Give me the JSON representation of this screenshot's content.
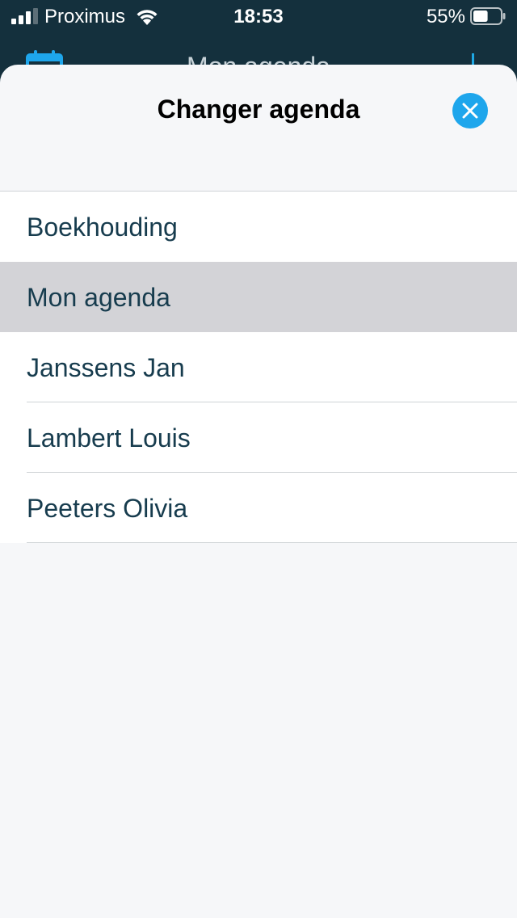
{
  "status_bar": {
    "carrier": "Proximus",
    "time": "18:53",
    "battery": "55%",
    "battery_level": 0.55
  },
  "background_header": {
    "title": "Mon agenda"
  },
  "sheet": {
    "title": "Changer agenda",
    "close_icon": "close-icon"
  },
  "agendas": [
    {
      "label": "Boekhouding",
      "selected": false
    },
    {
      "label": "Mon agenda",
      "selected": true
    },
    {
      "label": "Janssens Jan",
      "selected": false
    },
    {
      "label": "Lambert Louis",
      "selected": false
    },
    {
      "label": "Peeters Olivia",
      "selected": false
    }
  ],
  "colors": {
    "accent": "#1ea6ec",
    "selected_row": "#d3d3d7",
    "text": "#173c4e",
    "header_bg": "#14303d"
  }
}
